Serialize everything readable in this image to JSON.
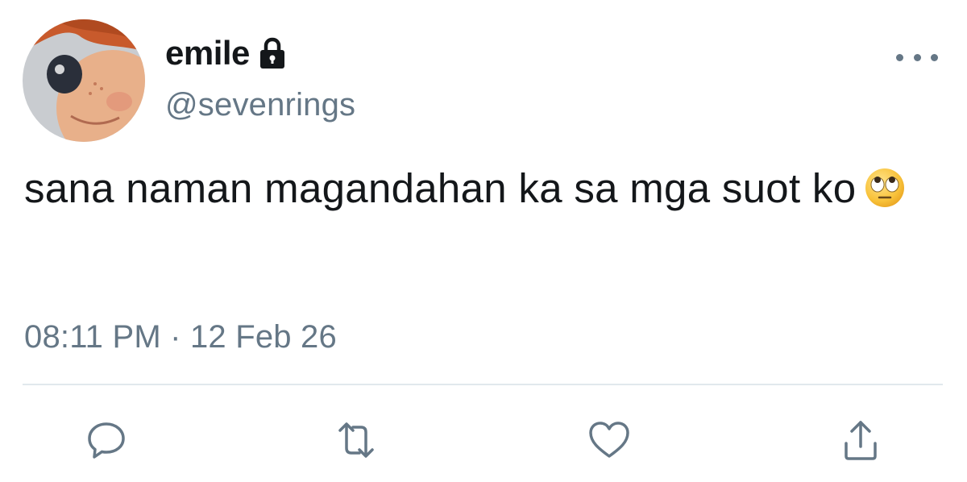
{
  "user": {
    "display_name": "emile",
    "handle": "@sevenrings",
    "protected_icon": "lock-icon",
    "avatar_icon": "avatar-image"
  },
  "tweet": {
    "text": "sana naman magandahan ka sa mga suot ko",
    "emoji": "face-with-rolling-eyes-emoji",
    "timestamp": "08:11 PM · 12 Feb 26"
  },
  "actions": [
    {
      "name": "reply",
      "icon": "reply-icon"
    },
    {
      "name": "retweet",
      "icon": "retweet-icon"
    },
    {
      "name": "like",
      "icon": "heart-icon"
    },
    {
      "name": "share",
      "icon": "share-icon"
    }
  ],
  "colors": {
    "primary_text": "#14171a",
    "secondary_text": "#657786",
    "divider": "#e1e8ed"
  }
}
